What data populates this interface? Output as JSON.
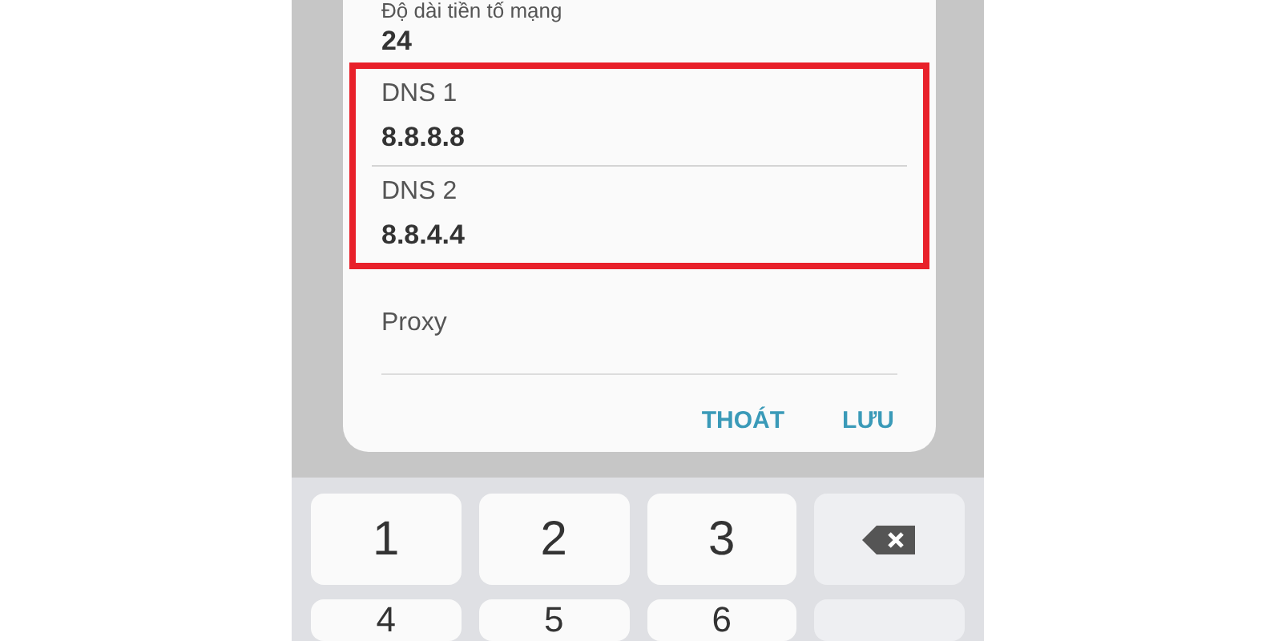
{
  "dialog": {
    "fields": [
      {
        "label": "Độ dài tiền tố mạng",
        "value": "24",
        "highlighted": false
      },
      {
        "label": "DNS 1",
        "value": "8.8.8.8",
        "highlighted": true
      },
      {
        "label": "DNS 2",
        "value": "8.8.4.4",
        "highlighted": true
      },
      {
        "label": "Proxy",
        "highlighted": false
      }
    ],
    "buttons": [
      "THOÁT",
      "LƯU"
    ]
  },
  "keyboard": {
    "rows": [
      [
        {
          "kind": "key",
          "label": "1"
        },
        {
          "kind": "key",
          "label": "2"
        },
        {
          "kind": "key",
          "label": "3"
        },
        {
          "kind": "backspace"
        }
      ],
      [
        {
          "kind": "key",
          "label": "4"
        },
        {
          "kind": "key",
          "label": "5"
        },
        {
          "kind": "key",
          "label": "6"
        },
        {
          "kind": "blank"
        }
      ]
    ]
  }
}
